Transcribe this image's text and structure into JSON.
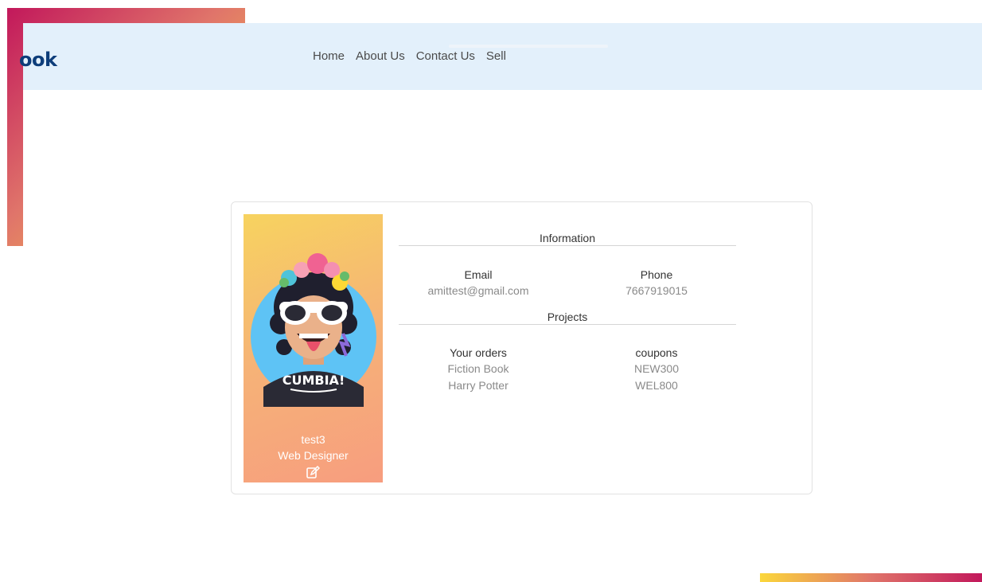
{
  "brand": {
    "text": "ook"
  },
  "nav": {
    "links": [
      "Home",
      "About Us",
      "Contact Us",
      "Sell"
    ]
  },
  "profile": {
    "avatar_caption": "CUMBIA!",
    "name": "test3",
    "role": "Web Designer",
    "edit_icon": "edit-icon"
  },
  "information": {
    "title": "Information",
    "email_label": "Email",
    "email_value": "amittest@gmail.com",
    "phone_label": "Phone",
    "phone_value": "7667919015"
  },
  "projects": {
    "title": "Projects",
    "orders_label": "Your orders",
    "orders": [
      "Fiction Book",
      "Harry Potter"
    ],
    "coupons_label": "coupons",
    "coupons": [
      "NEW300",
      "WEL800"
    ]
  },
  "colors": {
    "navbar_bg": "#e3f0fb",
    "brand": "#0d3d7a",
    "gradient_start": "#c2185b",
    "gradient_end": "#fbd73b"
  }
}
